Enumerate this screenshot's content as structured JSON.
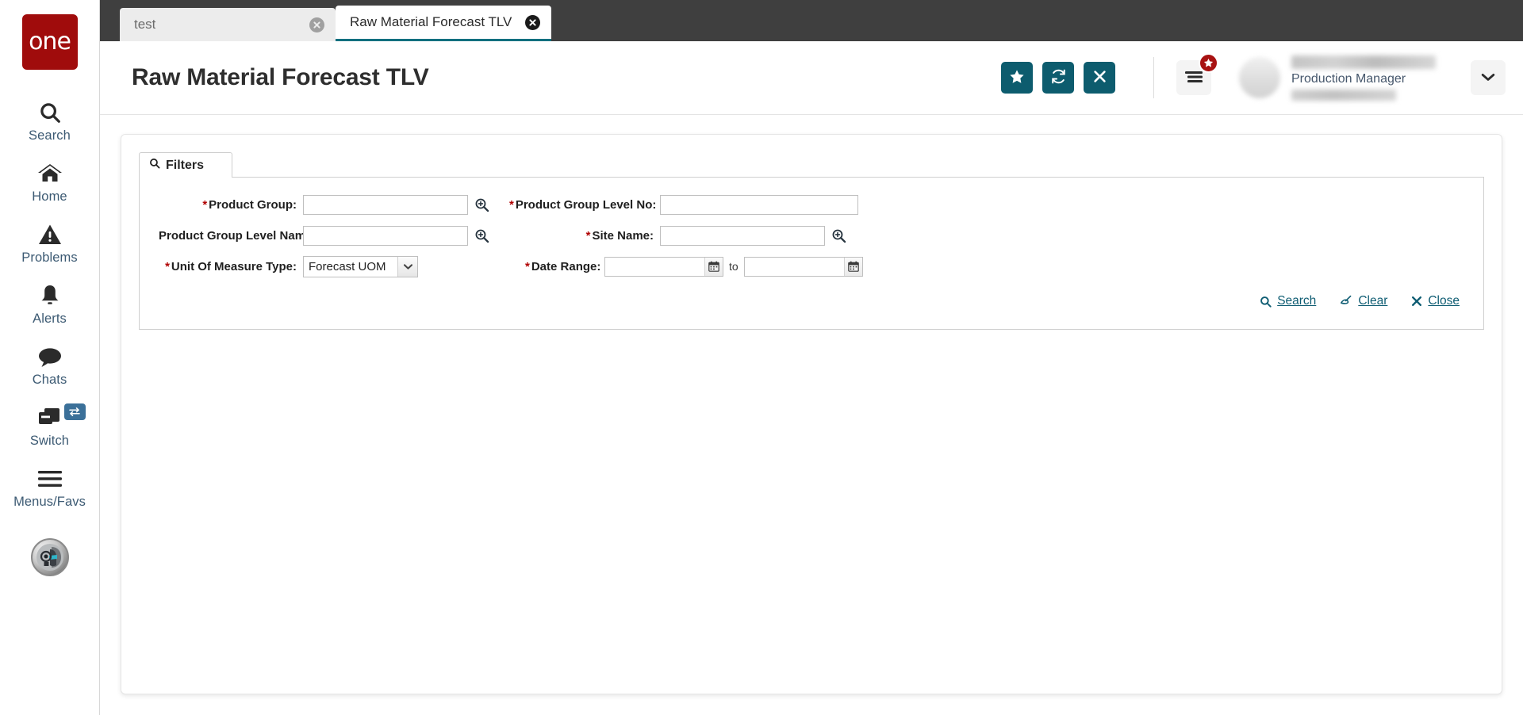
{
  "app": {
    "logo_text": "one"
  },
  "sidebar": {
    "items": [
      {
        "label": "Search",
        "icon": "search-icon"
      },
      {
        "label": "Home",
        "icon": "home-icon"
      },
      {
        "label": "Problems",
        "icon": "warning-triangle-icon"
      },
      {
        "label": "Alerts",
        "icon": "bell-icon"
      },
      {
        "label": "Chats",
        "icon": "chat-bubble-icon"
      },
      {
        "label": "Switch",
        "icon": "windows-stack-icon",
        "badge_icon": "swap-arrows-icon"
      },
      {
        "label": "Menus/Favs",
        "icon": "hamburger-icon"
      }
    ],
    "assistant_icon": "ai-assistant-orb-icon"
  },
  "tabs": [
    {
      "label": "test",
      "active": false,
      "close_icon": "close-circle-icon"
    },
    {
      "label": "Raw Material Forecast TLV",
      "active": true,
      "close_icon": "close-circle-icon"
    }
  ],
  "header": {
    "title": "Raw Material Forecast TLV",
    "buttons": [
      {
        "name": "favorite-button",
        "icon": "star-icon"
      },
      {
        "name": "refresh-button",
        "icon": "refresh-icon"
      },
      {
        "name": "close-button",
        "icon": "x-icon"
      }
    ],
    "menu_button": {
      "icon": "hamburger-icon",
      "badge_icon": "star-icon"
    },
    "user": {
      "name": "",
      "role": "Production Manager",
      "email": ""
    },
    "caret_icon": "chevron-down-icon"
  },
  "filters": {
    "tab_label": "Filters",
    "tab_icon": "search-icon",
    "fields": {
      "product_group": {
        "label": "Product Group:",
        "required": true,
        "value": "",
        "placeholder": "",
        "lookup": true
      },
      "product_group_level_no": {
        "label": "Product Group Level No:",
        "required": true,
        "value": "",
        "placeholder": "",
        "lookup": false
      },
      "product_group_level_name": {
        "label": "Product Group Level Name:",
        "required": false,
        "value": "",
        "placeholder": "",
        "lookup": true
      },
      "site_name": {
        "label": "Site Name:",
        "required": true,
        "value": "",
        "placeholder": "",
        "lookup": true
      },
      "unit_of_measure_type": {
        "label": "Unit Of Measure Type:",
        "required": true,
        "value": "Forecast UOM",
        "options": [
          "Forecast UOM"
        ]
      },
      "date_range": {
        "label": "Date Range:",
        "required": true,
        "from_value": "",
        "to_value": "",
        "separator": "to",
        "calendar_icon": "calendar-icon"
      }
    },
    "actions": [
      {
        "label": "Search",
        "icon": "search-icon"
      },
      {
        "label": "Clear",
        "icon": "broom-icon"
      },
      {
        "label": "Close",
        "icon": "x-icon"
      }
    ]
  },
  "colors": {
    "brand_red": "#a00c0c",
    "accent_teal": "#0d5c6e",
    "tab_underline": "#12707f",
    "required_star": "#b00000",
    "link": "#0f5d73",
    "badge_red": "#a81212",
    "switch_badge_blue": "#3b7099"
  }
}
